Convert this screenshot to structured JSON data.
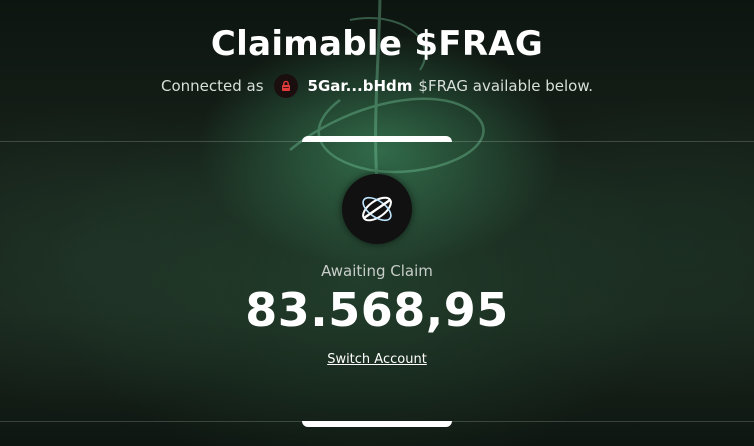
{
  "header": {
    "title": "Claimable $FRAG",
    "connected_prefix": "Connected as",
    "account_short": "5Gar...bHdm",
    "connected_suffix": "$FRAG available below."
  },
  "claim": {
    "status_label": "Awaiting Claim",
    "amount": "83.568,95",
    "switch_account_label": "Switch Account"
  },
  "icons": {
    "avatar": "lock-icon",
    "token_logo": "frag-logo-icon",
    "background": "script-glyph-decoration"
  },
  "colors": {
    "accent_green": "#46a06e",
    "avatar_lock": "#e23b3b",
    "text_primary": "#ffffff",
    "text_muted": "#c7cdc8"
  }
}
